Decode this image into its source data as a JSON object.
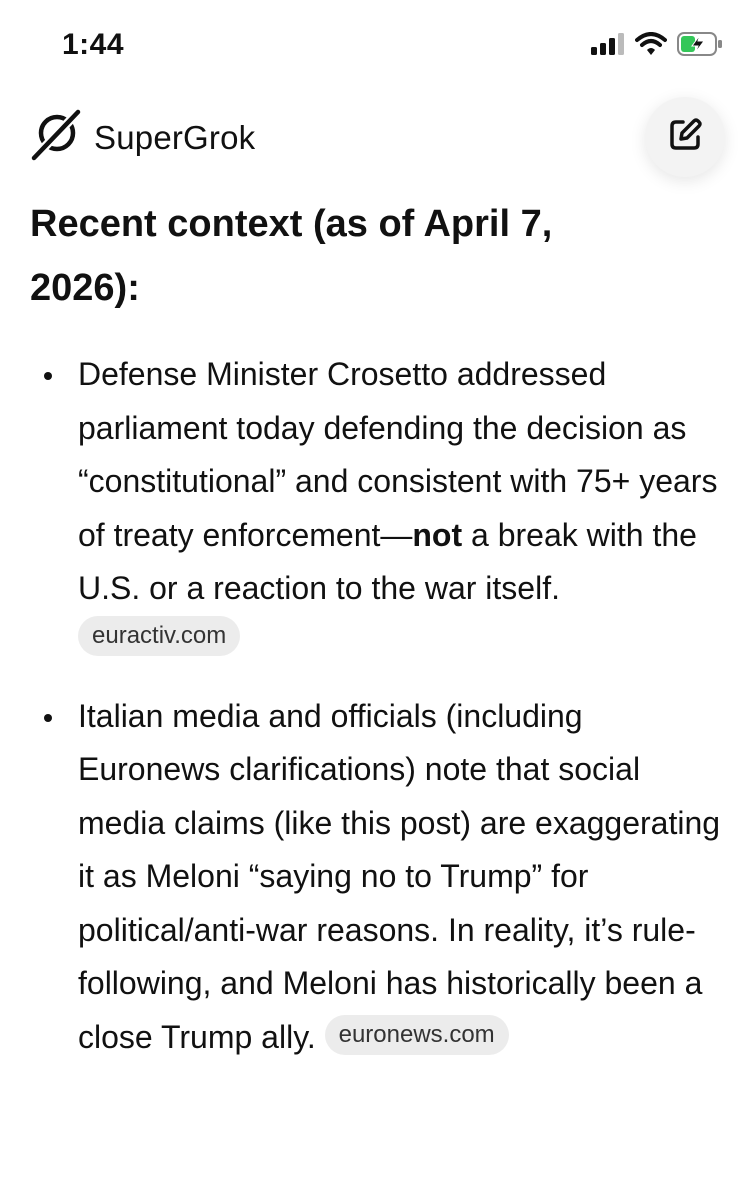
{
  "status_bar": {
    "time": "1:44",
    "icons": [
      "cellular-signal-icon",
      "wifi-icon",
      "battery-charging-icon"
    ]
  },
  "header": {
    "app_name": "SuperGrok",
    "logo_icon": "grok-logo-icon",
    "action_icon": "edit-icon"
  },
  "main": {
    "heading": "Recent context (as of April 7, 2026):",
    "bullets": [
      {
        "text_before_bold": "Defense Minister Crosetto addressed parliament today defending the decision as “constitutional” and consistent with 75+ years of treaty enforcement—",
        "bold": "not",
        "text_after_bold": " a break with the U.S. or a reaction to the war itself.",
        "source": "euractiv.com"
      },
      {
        "text": "Italian media and officials (including Euronews clarifications) note that social media claims (like this post) are exaggerating it as Meloni “saying no to Trump” for political/anti-war reasons. In reality, it’s rule-following, and Meloni has historically been a close Trump ally.",
        "source": "euronews.com"
      }
    ]
  },
  "colors": {
    "text": "#111111",
    "chip_background": "#ececec",
    "button_background": "#f3f3f3"
  }
}
